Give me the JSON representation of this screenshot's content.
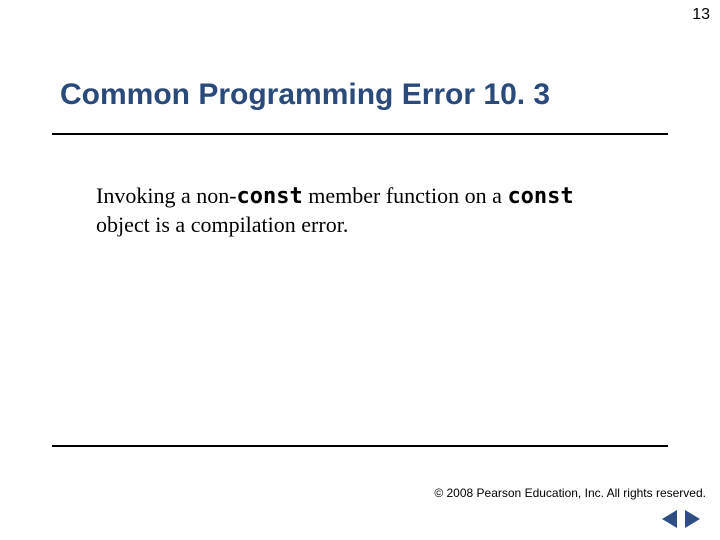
{
  "page_number": "13",
  "title": "Common Programming Error 10. 3",
  "body": {
    "seg1": "Invoking a non-",
    "kw1": "const",
    "seg2": " member function on a ",
    "kw2": "const",
    "seg3": " object is a compilation error."
  },
  "copyright": "© 2008 Pearson Education, Inc.  All rights reserved.",
  "nav": {
    "prev_icon": "prev-arrow-icon",
    "next_icon": "next-arrow-icon"
  }
}
